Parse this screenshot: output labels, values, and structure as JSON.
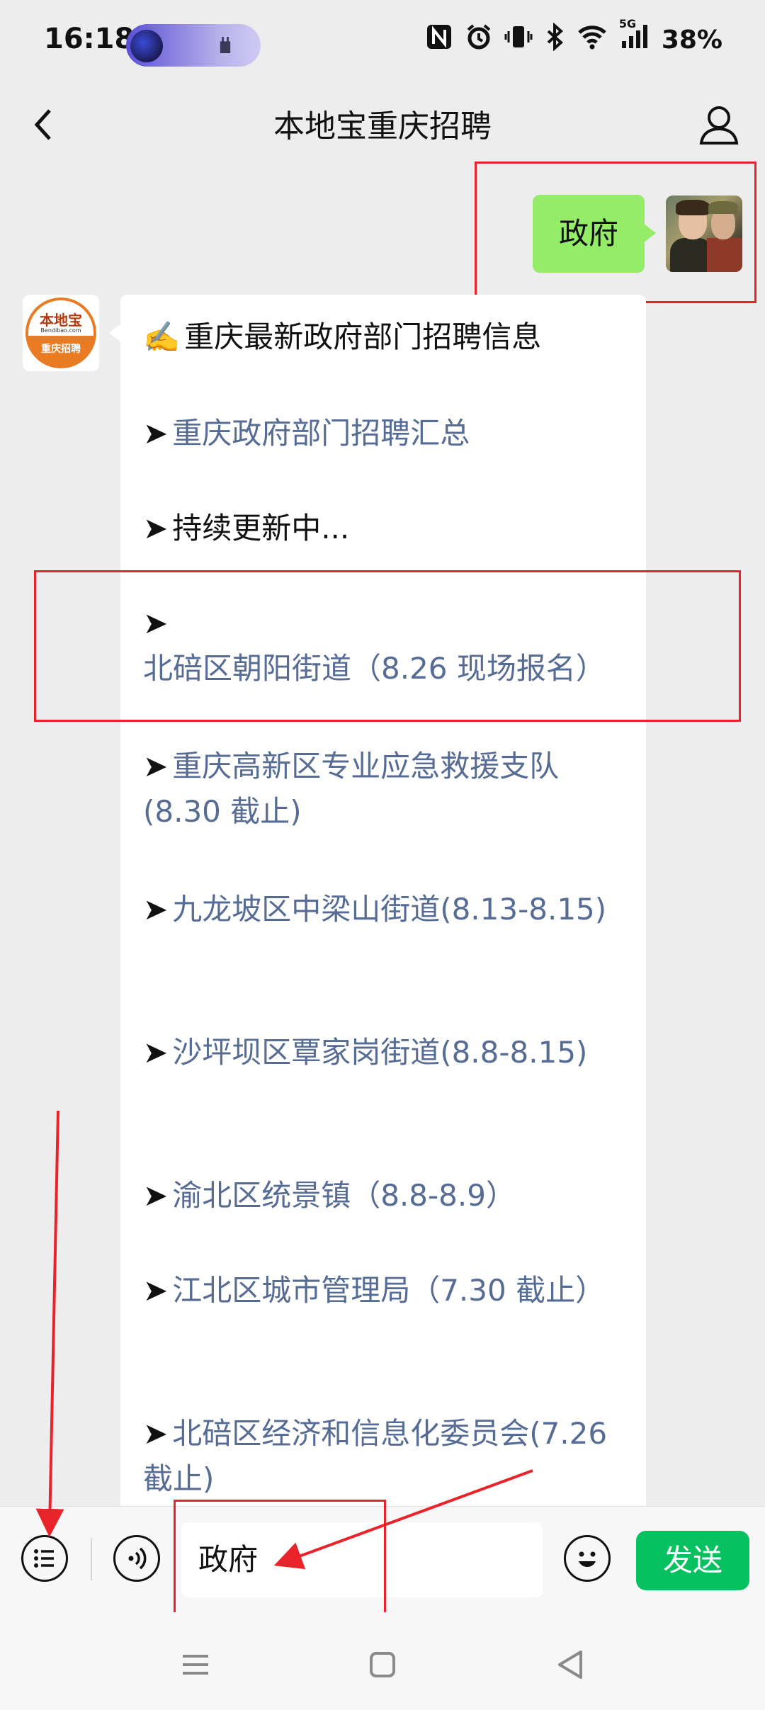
{
  "status_bar": {
    "time": "16:18",
    "battery": "38%",
    "signal": "5G",
    "icons": [
      "nfc-icon",
      "alarm-icon",
      "vibrate-icon",
      "bluetooth-icon",
      "wifi-icon",
      "cell-signal-icon"
    ]
  },
  "nav": {
    "title": "本地宝重庆招聘"
  },
  "chat": {
    "sent_message": "政府",
    "bot_avatar": {
      "brand": "本地宝",
      "sub": "Bendibao.com",
      "role": "重庆招聘"
    },
    "reply_lines": [
      {
        "arrow": "✍️",
        "text": "重庆最新政府部门招聘信息",
        "link": false
      },
      {
        "arrow": "➤",
        "text": "重庆政府部门招聘汇总",
        "link": true
      },
      {
        "arrow": "➤",
        "text": "持续更新中...",
        "link": false
      },
      {
        "arrow": "➤",
        "text": "北碚区朝阳街道（8.26 现场报名）",
        "link": true
      },
      {
        "arrow": "➤",
        "text": "重庆高新区专业应急救援支队(8.30 截止)",
        "link": true
      },
      {
        "arrow": "➤",
        "text": "九龙坡区中梁山街道(8.13-8.15)",
        "link": true
      },
      {
        "arrow": "➤",
        "text": "沙坪坝区覃家岗街道(8.8-8.15)",
        "link": true
      },
      {
        "arrow": "➤",
        "text": "渝北区统景镇（8.8-8.9）",
        "link": true
      },
      {
        "arrow": "➤",
        "text": "江北区城市管理局（7.30 截止）",
        "link": true
      },
      {
        "arrow": "➤",
        "text": "北碚区经济和信息化委员会(7.26 截止)",
        "link": true
      }
    ]
  },
  "input_bar": {
    "value": "政府",
    "send_label": "发送"
  },
  "colors": {
    "background": "#ededed",
    "sent_bubble": "#95ec69",
    "send_button": "#07c160",
    "link": "#566c94",
    "annotation": "#e8232a"
  }
}
